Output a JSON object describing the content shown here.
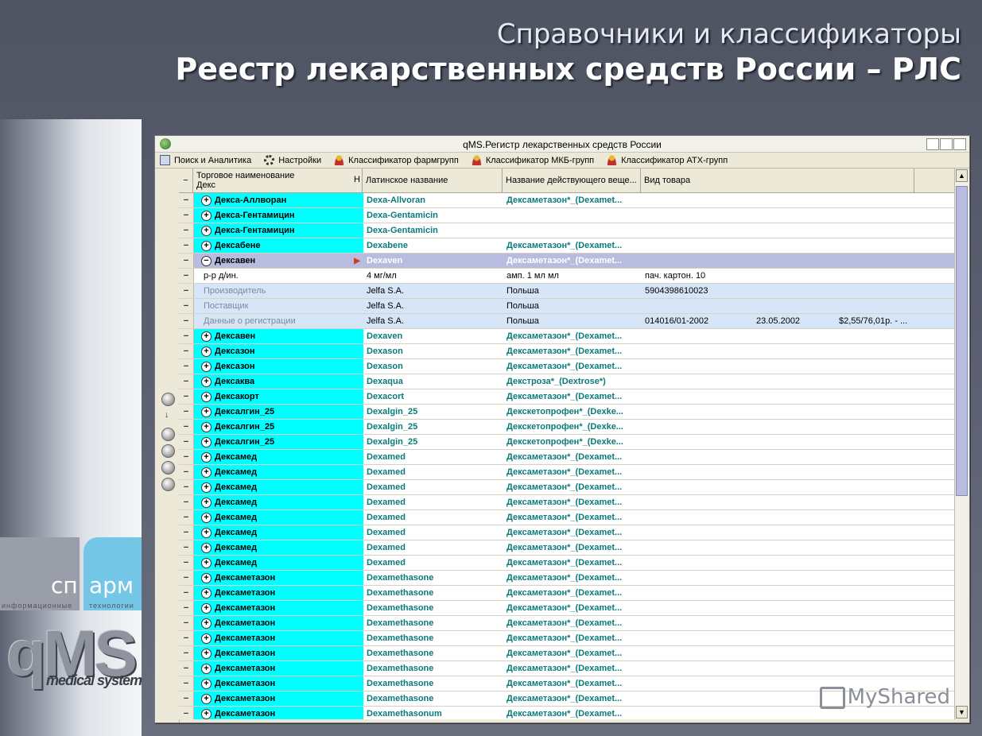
{
  "slide": {
    "title": "Справочники и классификаторы",
    "subtitle": "Реестр лекарственных средств России – РЛС"
  },
  "branding": {
    "logo_left": "сп",
    "logo_right": "арм",
    "logo_sub_left": "информационные",
    "logo_sub_right": "технологии",
    "product": "qMS",
    "product_sub": "medical system"
  },
  "window": {
    "title": "qMS.Регистр лекарственных средств России"
  },
  "menu": [
    {
      "label": "Поиск и Аналитика",
      "icon": "search-icon"
    },
    {
      "label": "Настройки",
      "icon": "gear-icon"
    },
    {
      "label": "Классификатор фармгрупп",
      "icon": "person-icon"
    },
    {
      "label": "Классификатор МКБ-групп",
      "icon": "person-icon"
    },
    {
      "label": "Классификатор АТХ-групп",
      "icon": "person-icon"
    }
  ],
  "grid": {
    "headers": {
      "trade_name": "Торговое наименование",
      "filter": "Декс",
      "h_marker": "Н",
      "latin": "Латинское название",
      "substance": "Название действующего веще...",
      "type": "Вид товара"
    },
    "rows": [
      {
        "kind": "item",
        "expander": "+",
        "name": "Декса-Аллворан",
        "latin": "Dexa-Allvoran",
        "substance": "Дексаметазон*_(Dexamet..."
      },
      {
        "kind": "item",
        "expander": "+",
        "name": "Декса-Гентамицин",
        "latin": "Dexa-Gentamicin",
        "substance": ""
      },
      {
        "kind": "item",
        "expander": "+",
        "name": "Декса-Гентамицин",
        "latin": "Dexa-Gentamicin",
        "substance": ""
      },
      {
        "kind": "item",
        "expander": "+",
        "name": "Дексабене",
        "latin": "Dexabene",
        "substance": "Дексаметазон*_(Dexamet..."
      },
      {
        "kind": "selected",
        "expander": "−",
        "name": "Дексавен",
        "latin": "Dexaven",
        "substance": "Дексаметазон*_(Dexamet..."
      },
      {
        "kind": "detail",
        "name": "р-р д/ин.",
        "latin": "4 мг/мл",
        "substance": "амп. 1 мл мл",
        "c4": "пач. картон. 10"
      },
      {
        "kind": "sub",
        "name": "Производитель",
        "latin": "Jelfa S.A.",
        "substance": "Польша",
        "c4": "5904398610023"
      },
      {
        "kind": "sub",
        "name": "Поставщик",
        "latin": "Jelfa S.A.",
        "substance": "Польша",
        "c4": ""
      },
      {
        "kind": "sub",
        "name": "Данные о регистрации",
        "latin": "Jelfa S.A.",
        "substance": "Польша",
        "c4": "014016/01-2002",
        "c5": "23.05.2002",
        "c6": "$2,55/76,01р. - ..."
      },
      {
        "kind": "item",
        "expander": "+",
        "name": "Дексавен",
        "latin": "Dexaven",
        "substance": "Дексаметазон*_(Dexamet..."
      },
      {
        "kind": "item",
        "expander": "+",
        "name": "Дексазон",
        "latin": "Dexason",
        "substance": "Дексаметазон*_(Dexamet..."
      },
      {
        "kind": "item",
        "expander": "+",
        "name": "Дексазон",
        "latin": "Dexason",
        "substance": "Дексаметазон*_(Dexamet..."
      },
      {
        "kind": "item",
        "expander": "+",
        "name": "Дексаква",
        "latin": "Dexaqua",
        "substance": "Декстроза*_(Dextrose*)"
      },
      {
        "kind": "item",
        "expander": "+",
        "name": "Дексакорт",
        "latin": "Dexacort",
        "substance": "Дексаметазон*_(Dexamet..."
      },
      {
        "kind": "item",
        "expander": "+",
        "name": "Дексалгин_25",
        "latin": "Dexalgin_25",
        "substance": "Декскетопрофен*_(Dexke..."
      },
      {
        "kind": "item",
        "expander": "+",
        "name": "Дексалгин_25",
        "latin": "Dexalgin_25",
        "substance": "Декскетопрофен*_(Dexke..."
      },
      {
        "kind": "item",
        "expander": "+",
        "name": "Дексалгин_25",
        "latin": "Dexalgin_25",
        "substance": "Декскетопрофен*_(Dexke..."
      },
      {
        "kind": "item",
        "expander": "+",
        "name": "Дексамед",
        "latin": "Dexamed",
        "substance": "Дексаметазон*_(Dexamet..."
      },
      {
        "kind": "item",
        "expander": "+",
        "name": "Дексамед",
        "latin": "Dexamed",
        "substance": "Дексаметазон*_(Dexamet..."
      },
      {
        "kind": "item",
        "expander": "+",
        "name": "Дексамед",
        "latin": "Dexamed",
        "substance": "Дексаметазон*_(Dexamet..."
      },
      {
        "kind": "item",
        "expander": "+",
        "name": "Дексамед",
        "latin": "Dexamed",
        "substance": "Дексаметазон*_(Dexamet..."
      },
      {
        "kind": "item",
        "expander": "+",
        "name": "Дексамед",
        "latin": "Dexamed",
        "substance": "Дексаметазон*_(Dexamet..."
      },
      {
        "kind": "item",
        "expander": "+",
        "name": "Дексамед",
        "latin": "Dexamed",
        "substance": "Дексаметазон*_(Dexamet..."
      },
      {
        "kind": "item",
        "expander": "+",
        "name": "Дексамед",
        "latin": "Dexamed",
        "substance": "Дексаметазон*_(Dexamet..."
      },
      {
        "kind": "item",
        "expander": "+",
        "name": "Дексамед",
        "latin": "Dexamed",
        "substance": "Дексаметазон*_(Dexamet..."
      },
      {
        "kind": "item",
        "expander": "+",
        "name": "Дексаметазон",
        "latin": "Dexamethasone",
        "substance": "Дексаметазон*_(Dexamet..."
      },
      {
        "kind": "item",
        "expander": "+",
        "name": "Дексаметазон",
        "latin": "Dexamethasone",
        "substance": "Дексаметазон*_(Dexamet..."
      },
      {
        "kind": "item",
        "expander": "+",
        "name": "Дексаметазон",
        "latin": "Dexamethasone",
        "substance": "Дексаметазон*_(Dexamet..."
      },
      {
        "kind": "item",
        "expander": "+",
        "name": "Дексаметазон",
        "latin": "Dexamethasone",
        "substance": "Дексаметазон*_(Dexamet..."
      },
      {
        "kind": "item",
        "expander": "+",
        "name": "Дексаметазон",
        "latin": "Dexamethasone",
        "substance": "Дексаметазон*_(Dexamet..."
      },
      {
        "kind": "item",
        "expander": "+",
        "name": "Дексаметазон",
        "latin": "Dexamethasone",
        "substance": "Дексаметазон*_(Dexamet..."
      },
      {
        "kind": "item",
        "expander": "+",
        "name": "Дексаметазон",
        "latin": "Dexamethasone",
        "substance": "Дексаметазон*_(Dexamet..."
      },
      {
        "kind": "item",
        "expander": "+",
        "name": "Дексаметазон",
        "latin": "Dexamethasone",
        "substance": "Дексаметазон*_(Dexamet..."
      },
      {
        "kind": "item",
        "expander": "+",
        "name": "Дексаметазон",
        "latin": "Dexamethasone",
        "substance": "Дексаметазон*_(Dexamet..."
      },
      {
        "kind": "item",
        "expander": "+",
        "name": "Дексаметазон",
        "latin": "Dexamethasonum",
        "substance": "Дексаметазон*_(Dexamet..."
      }
    ]
  },
  "watermark": "MyShared",
  "colors": {
    "highlight": "#00ffff",
    "selected": "#b8bde0",
    "subrow": "#d6e6f8",
    "latin_text": "#0b7a7a"
  }
}
